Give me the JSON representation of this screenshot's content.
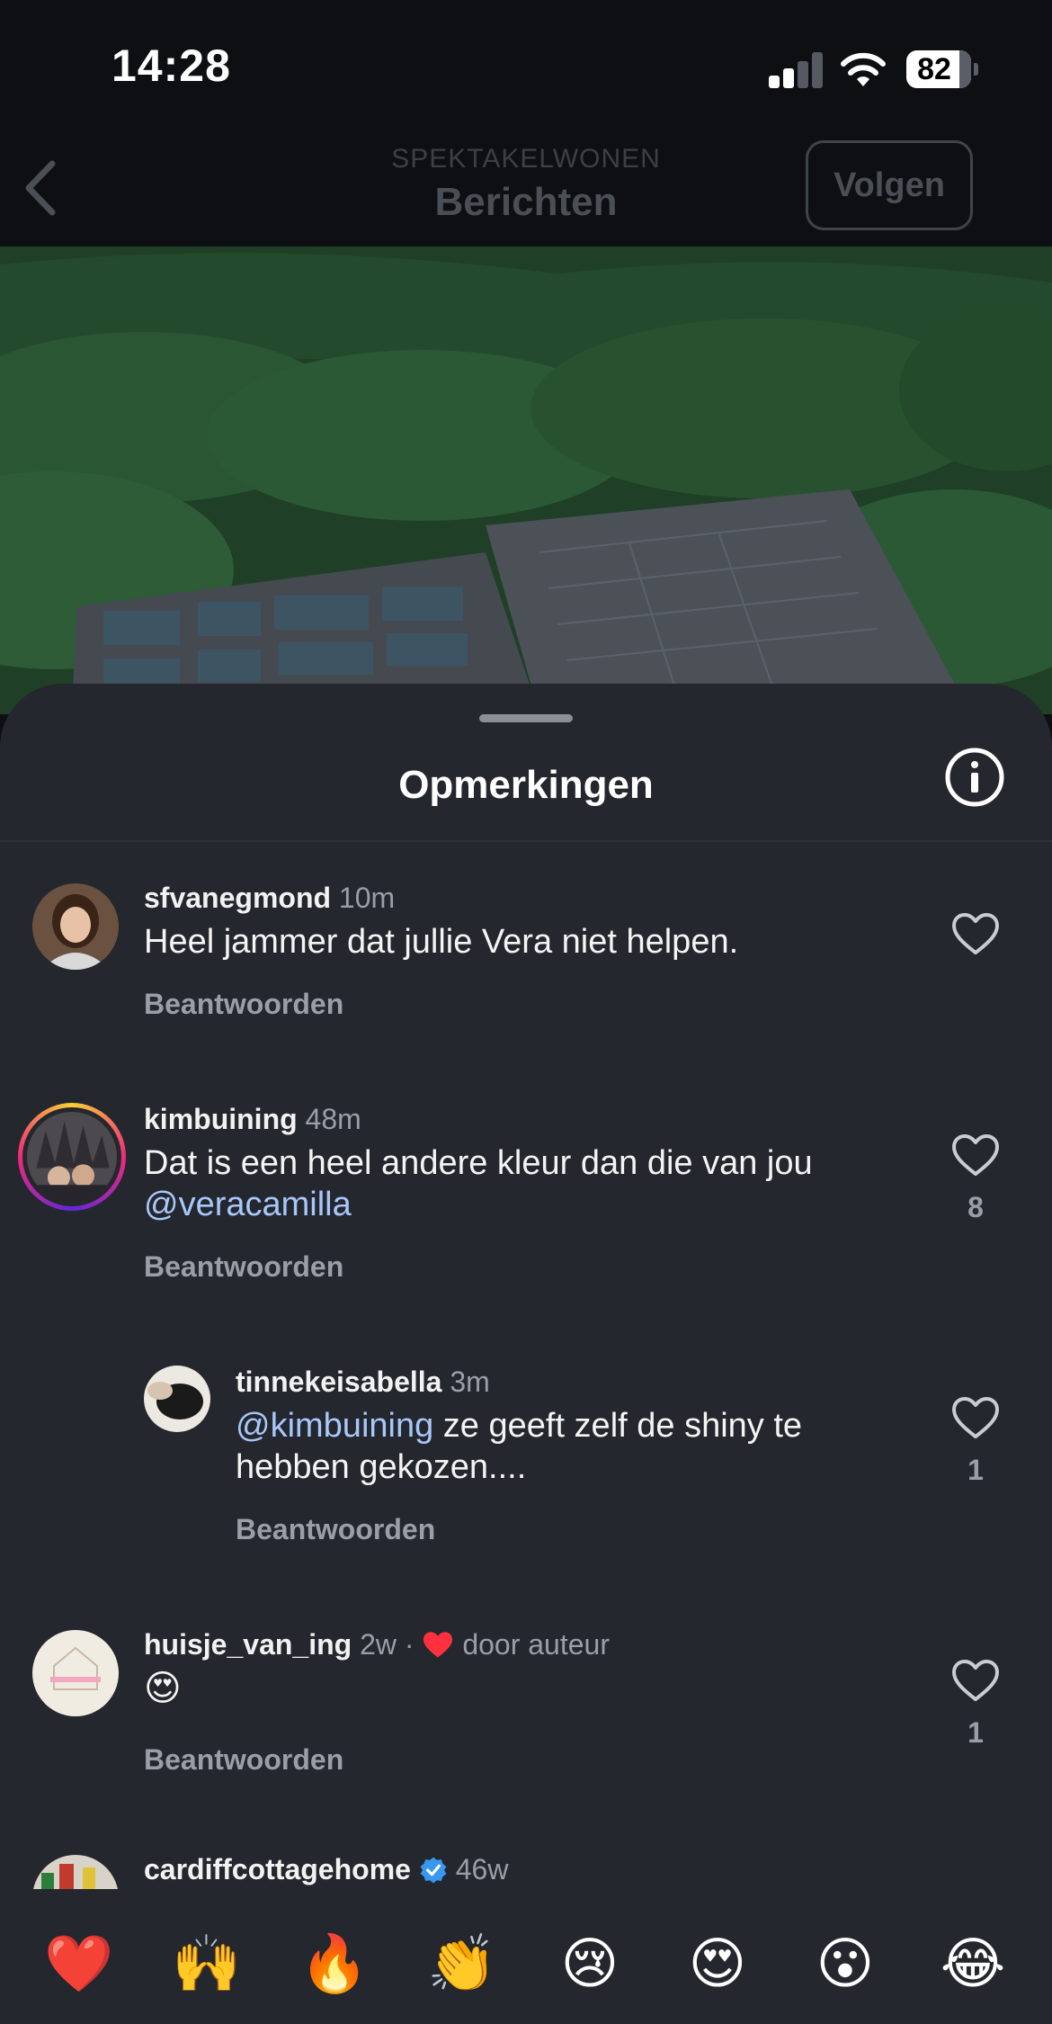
{
  "status": {
    "time": "14:28",
    "battery": "82"
  },
  "nav": {
    "subtitle": "SPEKTAKELWONEN",
    "title": "Berichten",
    "follow_label": "Volgen"
  },
  "sheet": {
    "title": "Opmerkingen"
  },
  "comments": [
    {
      "user": "sfvanegmond",
      "time": "10m",
      "text": "Heel jammer dat jullie Vera niet helpen.",
      "reply": "Beantwoorden"
    },
    {
      "user": "kimbuining",
      "time": "48m",
      "text": "Dat is een heel andere kleur dan die van jou",
      "mention": "@veracamilla",
      "reply": "Beantwoorden",
      "likes": "8"
    },
    {
      "user": "tinnekeisabella",
      "time": "3m",
      "mention": "@kimbuining",
      "text_after": " ze geeft zelf de shiny te",
      "text_line2": "hebben gekozen....",
      "reply": "Beantwoorden",
      "likes": "1"
    },
    {
      "user": "huisje_van_ing",
      "time": "2w",
      "author_like": "door auteur",
      "text": "😍",
      "reply": "Beantwoorden",
      "likes": "1"
    },
    {
      "user": "cardiffcottagehome",
      "time": "46w"
    }
  ],
  "emoji_bar": [
    "❤️",
    "🙌",
    "🔥",
    "👏",
    "😢",
    "😍",
    "😮",
    "😂"
  ],
  "icons": {
    "back": "chevron-left-icon",
    "info": "info-icon",
    "like": "heart-outline-icon",
    "verified": "verified-badge-icon"
  }
}
